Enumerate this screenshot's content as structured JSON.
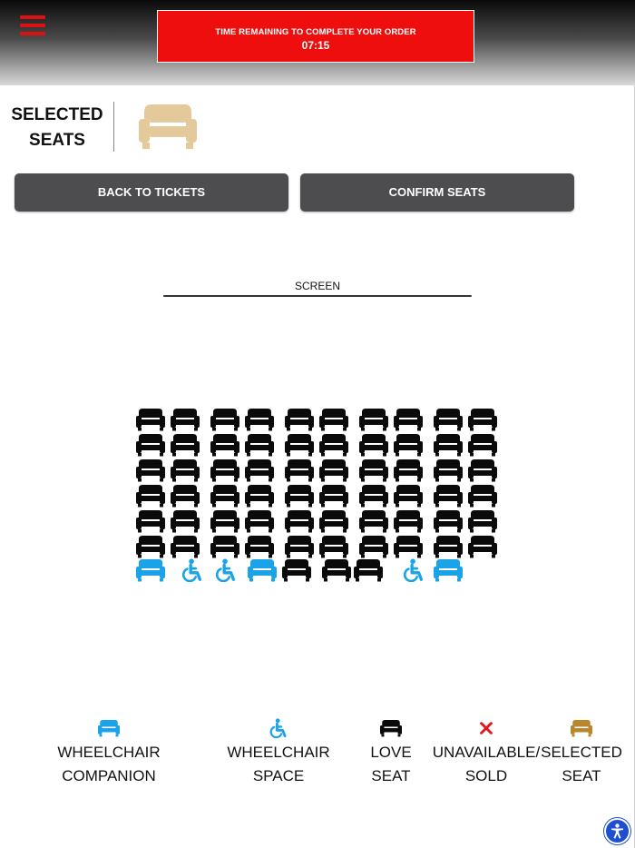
{
  "header": {
    "menu_icon": "hamburger-menu-icon",
    "timer_label": "TIME REMAINING TO COMPLETE YOUR ORDER",
    "timer_value": "07:15",
    "timer_color": "#ee0e0e"
  },
  "selection": {
    "title_line1": "SELECTED",
    "title_line2": "SEATS",
    "selected_icon": "armchair-icon",
    "selected_color": "#e4c99a"
  },
  "buttons": {
    "back": "BACK TO TICKETS",
    "confirm": "CONFIRM SEATS"
  },
  "screen": {
    "label": "SCREEN"
  },
  "seat_colors": {
    "love": "#0a0a0a",
    "wheelchair_companion": "#1aa3e8",
    "wheelchair_space": "#1aa3e8",
    "unavailable": "#e0161a",
    "selected": "#b8862c"
  },
  "seat_map": {
    "rows": [
      [
        "love",
        "love",
        "love",
        "love",
        "love",
        "love",
        "love",
        "love",
        "love",
        "love"
      ],
      [
        "love",
        "love",
        "love",
        "love",
        "love",
        "love",
        "love",
        "love",
        "love",
        "love"
      ],
      [
        "love",
        "love",
        "love",
        "love",
        "love",
        "love",
        "love",
        "love",
        "love",
        "love"
      ],
      [
        "love",
        "love",
        "love",
        "love",
        "love",
        "love",
        "love",
        "love",
        "love",
        "love"
      ],
      [
        "love",
        "love",
        "love",
        "love",
        "love",
        "love",
        "love",
        "love",
        "love",
        "love"
      ],
      [
        "love",
        "love",
        "love",
        "love",
        "love",
        "love",
        "love",
        "love",
        "love",
        "love"
      ],
      [
        "companion",
        "wheelchair",
        "wheelchair",
        "companion",
        "love",
        "love",
        "love",
        "wheelchair",
        "companion"
      ]
    ]
  },
  "legend": [
    {
      "type": "companion",
      "icon": "armchair-icon",
      "line1": "WHEELCHAIR",
      "line2": "COMPANION"
    },
    {
      "type": "wheelchair",
      "icon": "wheelchair-icon",
      "line1": "WHEELCHAIR",
      "line2": "SPACE"
    },
    {
      "type": "love",
      "icon": "armchair-icon",
      "line1": "LOVE",
      "line2": "SEAT"
    },
    {
      "type": "unavailable",
      "icon": "x-mark-icon",
      "line1": "UNAVAILABLE/",
      "line2": "SOLD"
    },
    {
      "type": "selected",
      "icon": "armchair-icon",
      "line1": "SELECTED",
      "line2": "SEAT"
    }
  ],
  "accessibility_icon": "accessibility-person-icon"
}
